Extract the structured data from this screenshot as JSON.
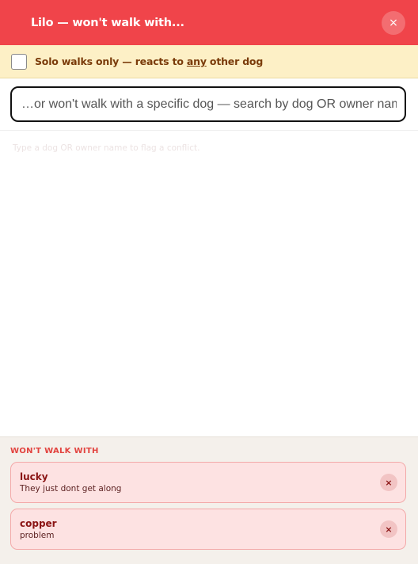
{
  "header": {
    "title": "Lilo — won't walk with...",
    "close_symbol": "×"
  },
  "solo": {
    "label_before": "Solo walks only — reacts to ",
    "label_emphasis": "any",
    "label_after": " other dog",
    "checked": false
  },
  "search": {
    "placeholder": "…or won't walk with a specific dog — search by dog OR owner name",
    "value": ""
  },
  "hint": "Type a dog OR owner name to flag a conflict.",
  "conflicts": {
    "title": "WON'T WALK WITH",
    "items": [
      {
        "name": "lucky",
        "reason": "They just dont get along",
        "remove_symbol": "×"
      },
      {
        "name": "copper",
        "reason": "problem",
        "remove_symbol": "×"
      }
    ]
  },
  "colors": {
    "header_bg": "#f0444a",
    "solo_bg": "#fdf0c6",
    "card_bg": "#fde2e2",
    "section_title": "#e2433f"
  }
}
